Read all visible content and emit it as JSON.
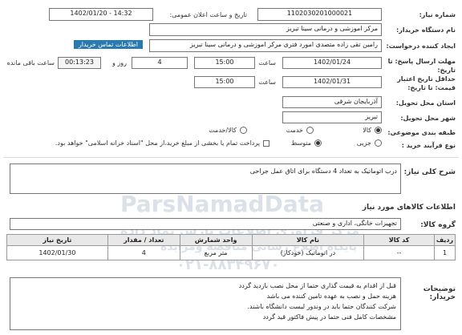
{
  "form": {
    "need_no_label": "شماره نیاز:",
    "need_no": "1102030201000021",
    "announce_label": "تاریخ و ساعت اعلان عمومی:",
    "announce_value": "1402/01/20 - 14:32",
    "buyer_label": "نام دستگاه خریدار:",
    "buyer": "مرکز اموزشی و درمانی سینا تبریز",
    "creator_label": "ایجاد کننده درخواست:",
    "creator": "رامین تقی زاده متصدی امورد فتری مرکز اموزشی و درمانی سینا تبریز",
    "contact_link": "اطلاعات تماس خریدار",
    "deadline_label": "مهلت ارسال پاسخ: تا تاریخ:",
    "deadline_date": "1402/01/24",
    "time_label": "ساعت",
    "deadline_time": "15:00",
    "days_value": "4",
    "days_label": "روز و",
    "remaining_time": "00:13:23",
    "remaining_label": "ساعت باقی مانده",
    "validity_label": "حداقل تاریخ اعتبار قیمت: تا تاریخ:",
    "validity_date": "1402/01/31",
    "validity_time": "15:00",
    "province_label": "استان محل تحویل:",
    "province": "آذربایجان شرقی",
    "city_label": "شهر محل تحویل:",
    "city": "تبریز",
    "category_label": "طبقه بندی موضوعی:",
    "category_options": [
      "کالا",
      "خدمت",
      "کالا/خدمت"
    ],
    "process_label": "نوع فرآیند خرید :",
    "process_options": [
      "جزیی",
      "متوسط"
    ],
    "payment_note": "پرداخت تمام یا بخشی از مبلغ خرید،از محل \"اسناد خزانه اسلامی\" خواهد بود."
  },
  "summary": {
    "label": "شرح کلی نیاز:",
    "text": "درب اتوماتیک به تعداد 4 دستگاه برای اتاق عمل جراحی"
  },
  "goods": {
    "section_title": "اطلاعات کالاهای مورد نیاز",
    "group_label": "گروه کالا:",
    "group_value": "تجهیزات خانگی، اداری و صنعتی",
    "columns": [
      "ردیف",
      "کد کالا",
      "نام کالا",
      "واحد شمارش",
      "تعداد / مقدار",
      "تاریخ نیاز"
    ],
    "rows": [
      [
        "1",
        "--",
        "در اتوماتیک (خودکار)",
        "متر مربع",
        "4",
        "1402/01/30"
      ]
    ]
  },
  "notes": {
    "label": "توضیحات خریدار:",
    "lines": [
      "قبل از اقدام به قیمت گذاری حتما از محل نصب بازدید گردد",
      "هزینه حمل و نصب به عهده تامین کننده می باشد",
      "شرکت کنندگان حتما باید در وندور لیست دانشگاه باشند.",
      "مشخصات کامل فنی حتما در پیش فاکتور قید گردد"
    ]
  },
  "watermark": {
    "line1": "ParsNamadData",
    "line2": "مرکز فرآوری اطلاعات پارس نماد داده",
    "line3": "پایگاه اطلاع رسانی مناقصه ومزایده",
    "line4": "۰۲۱-۸۸۳۴۹۶۷۰"
  },
  "colors": {
    "header_bg": "#e8e8e8",
    "link_bg": "#2a7ab0"
  }
}
